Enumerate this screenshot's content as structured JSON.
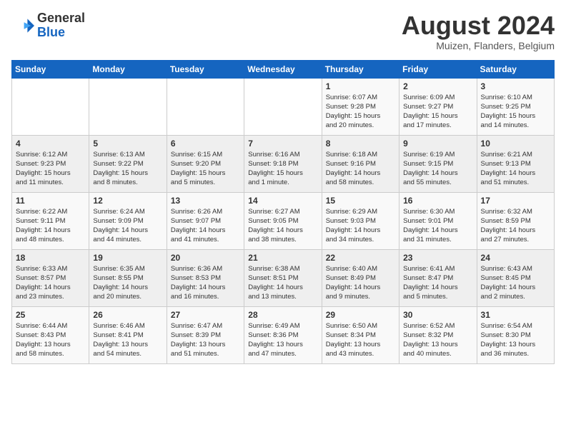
{
  "logo": {
    "general": "General",
    "blue": "Blue"
  },
  "header": {
    "month_year": "August 2024",
    "location": "Muizen, Flanders, Belgium"
  },
  "weekdays": [
    "Sunday",
    "Monday",
    "Tuesday",
    "Wednesday",
    "Thursday",
    "Friday",
    "Saturday"
  ],
  "weeks": [
    [
      {
        "day": "",
        "info": ""
      },
      {
        "day": "",
        "info": ""
      },
      {
        "day": "",
        "info": ""
      },
      {
        "day": "",
        "info": ""
      },
      {
        "day": "1",
        "info": "Sunrise: 6:07 AM\nSunset: 9:28 PM\nDaylight: 15 hours\nand 20 minutes."
      },
      {
        "day": "2",
        "info": "Sunrise: 6:09 AM\nSunset: 9:27 PM\nDaylight: 15 hours\nand 17 minutes."
      },
      {
        "day": "3",
        "info": "Sunrise: 6:10 AM\nSunset: 9:25 PM\nDaylight: 15 hours\nand 14 minutes."
      }
    ],
    [
      {
        "day": "4",
        "info": "Sunrise: 6:12 AM\nSunset: 9:23 PM\nDaylight: 15 hours\nand 11 minutes."
      },
      {
        "day": "5",
        "info": "Sunrise: 6:13 AM\nSunset: 9:22 PM\nDaylight: 15 hours\nand 8 minutes."
      },
      {
        "day": "6",
        "info": "Sunrise: 6:15 AM\nSunset: 9:20 PM\nDaylight: 15 hours\nand 5 minutes."
      },
      {
        "day": "7",
        "info": "Sunrise: 6:16 AM\nSunset: 9:18 PM\nDaylight: 15 hours\nand 1 minute."
      },
      {
        "day": "8",
        "info": "Sunrise: 6:18 AM\nSunset: 9:16 PM\nDaylight: 14 hours\nand 58 minutes."
      },
      {
        "day": "9",
        "info": "Sunrise: 6:19 AM\nSunset: 9:15 PM\nDaylight: 14 hours\nand 55 minutes."
      },
      {
        "day": "10",
        "info": "Sunrise: 6:21 AM\nSunset: 9:13 PM\nDaylight: 14 hours\nand 51 minutes."
      }
    ],
    [
      {
        "day": "11",
        "info": "Sunrise: 6:22 AM\nSunset: 9:11 PM\nDaylight: 14 hours\nand 48 minutes."
      },
      {
        "day": "12",
        "info": "Sunrise: 6:24 AM\nSunset: 9:09 PM\nDaylight: 14 hours\nand 44 minutes."
      },
      {
        "day": "13",
        "info": "Sunrise: 6:26 AM\nSunset: 9:07 PM\nDaylight: 14 hours\nand 41 minutes."
      },
      {
        "day": "14",
        "info": "Sunrise: 6:27 AM\nSunset: 9:05 PM\nDaylight: 14 hours\nand 38 minutes."
      },
      {
        "day": "15",
        "info": "Sunrise: 6:29 AM\nSunset: 9:03 PM\nDaylight: 14 hours\nand 34 minutes."
      },
      {
        "day": "16",
        "info": "Sunrise: 6:30 AM\nSunset: 9:01 PM\nDaylight: 14 hours\nand 31 minutes."
      },
      {
        "day": "17",
        "info": "Sunrise: 6:32 AM\nSunset: 8:59 PM\nDaylight: 14 hours\nand 27 minutes."
      }
    ],
    [
      {
        "day": "18",
        "info": "Sunrise: 6:33 AM\nSunset: 8:57 PM\nDaylight: 14 hours\nand 23 minutes."
      },
      {
        "day": "19",
        "info": "Sunrise: 6:35 AM\nSunset: 8:55 PM\nDaylight: 14 hours\nand 20 minutes."
      },
      {
        "day": "20",
        "info": "Sunrise: 6:36 AM\nSunset: 8:53 PM\nDaylight: 14 hours\nand 16 minutes."
      },
      {
        "day": "21",
        "info": "Sunrise: 6:38 AM\nSunset: 8:51 PM\nDaylight: 14 hours\nand 13 minutes."
      },
      {
        "day": "22",
        "info": "Sunrise: 6:40 AM\nSunset: 8:49 PM\nDaylight: 14 hours\nand 9 minutes."
      },
      {
        "day": "23",
        "info": "Sunrise: 6:41 AM\nSunset: 8:47 PM\nDaylight: 14 hours\nand 5 minutes."
      },
      {
        "day": "24",
        "info": "Sunrise: 6:43 AM\nSunset: 8:45 PM\nDaylight: 14 hours\nand 2 minutes."
      }
    ],
    [
      {
        "day": "25",
        "info": "Sunrise: 6:44 AM\nSunset: 8:43 PM\nDaylight: 13 hours\nand 58 minutes."
      },
      {
        "day": "26",
        "info": "Sunrise: 6:46 AM\nSunset: 8:41 PM\nDaylight: 13 hours\nand 54 minutes."
      },
      {
        "day": "27",
        "info": "Sunrise: 6:47 AM\nSunset: 8:39 PM\nDaylight: 13 hours\nand 51 minutes."
      },
      {
        "day": "28",
        "info": "Sunrise: 6:49 AM\nSunset: 8:36 PM\nDaylight: 13 hours\nand 47 minutes."
      },
      {
        "day": "29",
        "info": "Sunrise: 6:50 AM\nSunset: 8:34 PM\nDaylight: 13 hours\nand 43 minutes."
      },
      {
        "day": "30",
        "info": "Sunrise: 6:52 AM\nSunset: 8:32 PM\nDaylight: 13 hours\nand 40 minutes."
      },
      {
        "day": "31",
        "info": "Sunrise: 6:54 AM\nSunset: 8:30 PM\nDaylight: 13 hours\nand 36 minutes."
      }
    ]
  ]
}
